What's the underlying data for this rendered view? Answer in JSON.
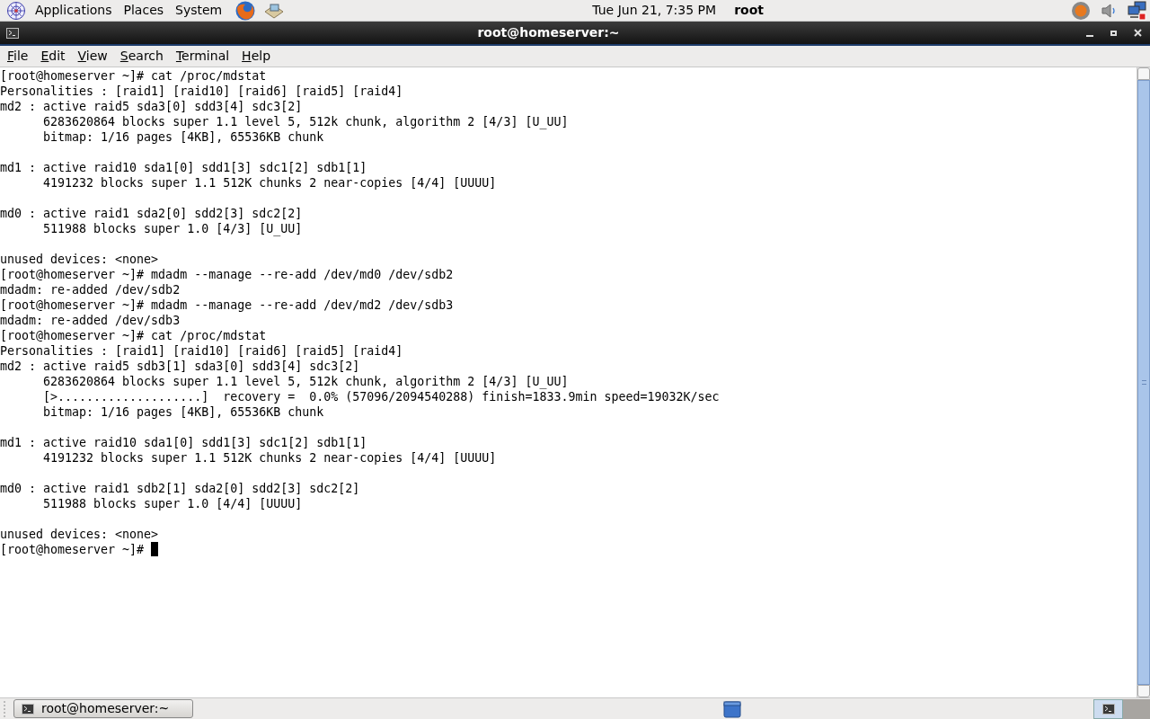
{
  "top_panel": {
    "menus": [
      "Applications",
      "Places",
      "System"
    ],
    "clock": "Tue Jun 21,  7:35 PM",
    "user": "root"
  },
  "window": {
    "title": "root@homeserver:~"
  },
  "menu_bar": [
    "File",
    "Edit",
    "View",
    "Search",
    "Terminal",
    "Help"
  ],
  "terminal": {
    "lines": [
      {
        "kind": "text",
        "text": "[root@homeserver ~]# cat /proc/mdstat"
      },
      {
        "kind": "text",
        "text": "Personalities : [raid1] [raid10] [raid6] [raid5] [raid4]"
      },
      {
        "kind": "text",
        "text": "md2 : active raid5 sda3[0] sdd3[4] sdc3[2]"
      },
      {
        "kind": "text",
        "text": "      6283620864 blocks super 1.1 level 5, 512k chunk, algorithm 2 [4/3] [U_UU]"
      },
      {
        "kind": "text",
        "text": "      bitmap: 1/16 pages [4KB], 65536KB chunk"
      },
      {
        "kind": "blank"
      },
      {
        "kind": "text",
        "text": "md1 : active raid10 sda1[0] sdd1[3] sdc1[2] sdb1[1]"
      },
      {
        "kind": "text",
        "text": "      4191232 blocks super 1.1 512K chunks 2 near-copies [4/4] [UUUU]"
      },
      {
        "kind": "blank"
      },
      {
        "kind": "text",
        "text": "md0 : active raid1 sda2[0] sdd2[3] sdc2[2]"
      },
      {
        "kind": "text",
        "text": "      511988 blocks super 1.0 [4/3] [U_UU]"
      },
      {
        "kind": "blank"
      },
      {
        "kind": "text",
        "text": "unused devices: <none>"
      },
      {
        "kind": "text",
        "text": "[root@homeserver ~]# mdadm --manage --re-add /dev/md0 /dev/sdb2"
      },
      {
        "kind": "text",
        "text": "mdadm: re-added /dev/sdb2"
      },
      {
        "kind": "text",
        "text": "[root@homeserver ~]# mdadm --manage --re-add /dev/md2 /dev/sdb3"
      },
      {
        "kind": "text",
        "text": "mdadm: re-added /dev/sdb3"
      },
      {
        "kind": "text",
        "text": "[root@homeserver ~]# cat /proc/mdstat"
      },
      {
        "kind": "text",
        "text": "Personalities : [raid1] [raid10] [raid6] [raid5] [raid4]"
      },
      {
        "kind": "text",
        "text": "md2 : active raid5 sdb3[1] sda3[0] sdd3[4] sdc3[2]"
      },
      {
        "kind": "text",
        "text": "      6283620864 blocks super 1.1 level 5, 512k chunk, algorithm 2 [4/3] [U_UU]"
      },
      {
        "kind": "text",
        "text": "      [>....................]  recovery =  0.0% (57096/2094540288) finish=1833.9min speed=19032K/sec"
      },
      {
        "kind": "text",
        "text": "      bitmap: 1/16 pages [4KB], 65536KB chunk"
      },
      {
        "kind": "blank"
      },
      {
        "kind": "text",
        "text": "md1 : active raid10 sda1[0] sdd1[3] sdc1[2] sdb1[1]"
      },
      {
        "kind": "text",
        "text": "      4191232 blocks super 1.1 512K chunks 2 near-copies [4/4] [UUUU]"
      },
      {
        "kind": "blank"
      },
      {
        "kind": "text",
        "text": "md0 : active raid1 sdb2[1] sda2[0] sdd2[3] sdc2[2]"
      },
      {
        "kind": "text",
        "text": "      511988 blocks super 1.0 [4/4] [UUUU]"
      },
      {
        "kind": "blank"
      },
      {
        "kind": "text",
        "text": "unused devices: <none>"
      },
      {
        "kind": "prompt",
        "text": "[root@homeserver ~]# "
      }
    ]
  },
  "taskbar": {
    "tasks": [
      {
        "label": "root@homeserver:~",
        "selected": false
      }
    ]
  }
}
